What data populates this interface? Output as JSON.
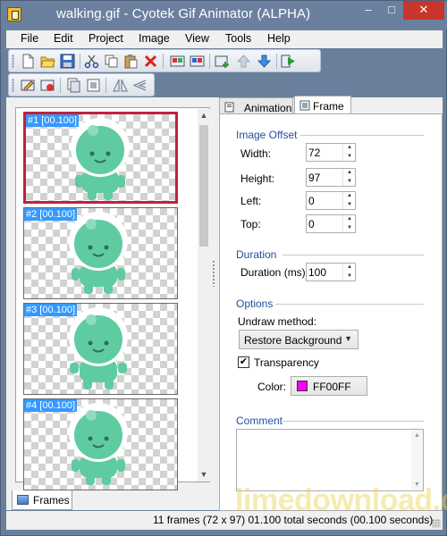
{
  "window": {
    "title": "walking.gif - Cyotek Gif Animator (ALPHA)",
    "controls": {
      "minimize": "–",
      "maximize": "□",
      "close": "✕"
    }
  },
  "menu": [
    "File",
    "Edit",
    "Project",
    "Image",
    "View",
    "Tools",
    "Help"
  ],
  "toolbar1": [
    "new-icon",
    "open-icon",
    "save-icon",
    "cut-icon",
    "copy-icon",
    "paste-icon",
    "delete-icon",
    "import-frames-icon",
    "export-frames-icon",
    "add-frame-icon",
    "move-up-icon",
    "move-down-icon",
    "play-icon"
  ],
  "toolbar2": [
    "edit-frame-icon",
    "resize-icon",
    "copy-frame-icon",
    "duplicate-icon",
    "flip-icon",
    "reverse-icon"
  ],
  "frames": [
    {
      "label": "#1 [00.100]",
      "selected": true
    },
    {
      "label": "#2 [00.100]",
      "selected": false
    },
    {
      "label": "#3 [00.100]",
      "selected": false
    },
    {
      "label": "#4 [00.100]",
      "selected": false
    }
  ],
  "frames_tab": {
    "label": "Frames"
  },
  "tabs": {
    "animation": "Animation",
    "frame": "Frame",
    "active": "Frame"
  },
  "image_offset": {
    "title": "Image Offset",
    "width_label": "Width:",
    "width_value": "72",
    "height_label": "Height:",
    "height_value": "97",
    "left_label": "Left:",
    "left_value": "0",
    "top_label": "Top:",
    "top_value": "0"
  },
  "duration": {
    "title": "Duration",
    "label": "Duration (ms):",
    "value": "100"
  },
  "options": {
    "title": "Options",
    "undraw_label": "Undraw method:",
    "undraw_value": "Restore Background",
    "transparency_label": "Transparency",
    "transparency_checked": true,
    "check_glyph": "✔",
    "color_label": "Color:",
    "color_value": "FF00FF",
    "color_hex": "#ff00ff"
  },
  "comment": {
    "title": "Comment",
    "value": ""
  },
  "status": {
    "text": "11 frames (72 x 97)   01.100 total seconds (00.100 seconds)"
  },
  "watermark": "limedownload.com",
  "colors": {
    "accent": "#1f4e9e",
    "selection": "#c0213c",
    "label_bg": "#3399ff",
    "sprite": "#5fcba0",
    "titlebar": "#6b809e"
  }
}
